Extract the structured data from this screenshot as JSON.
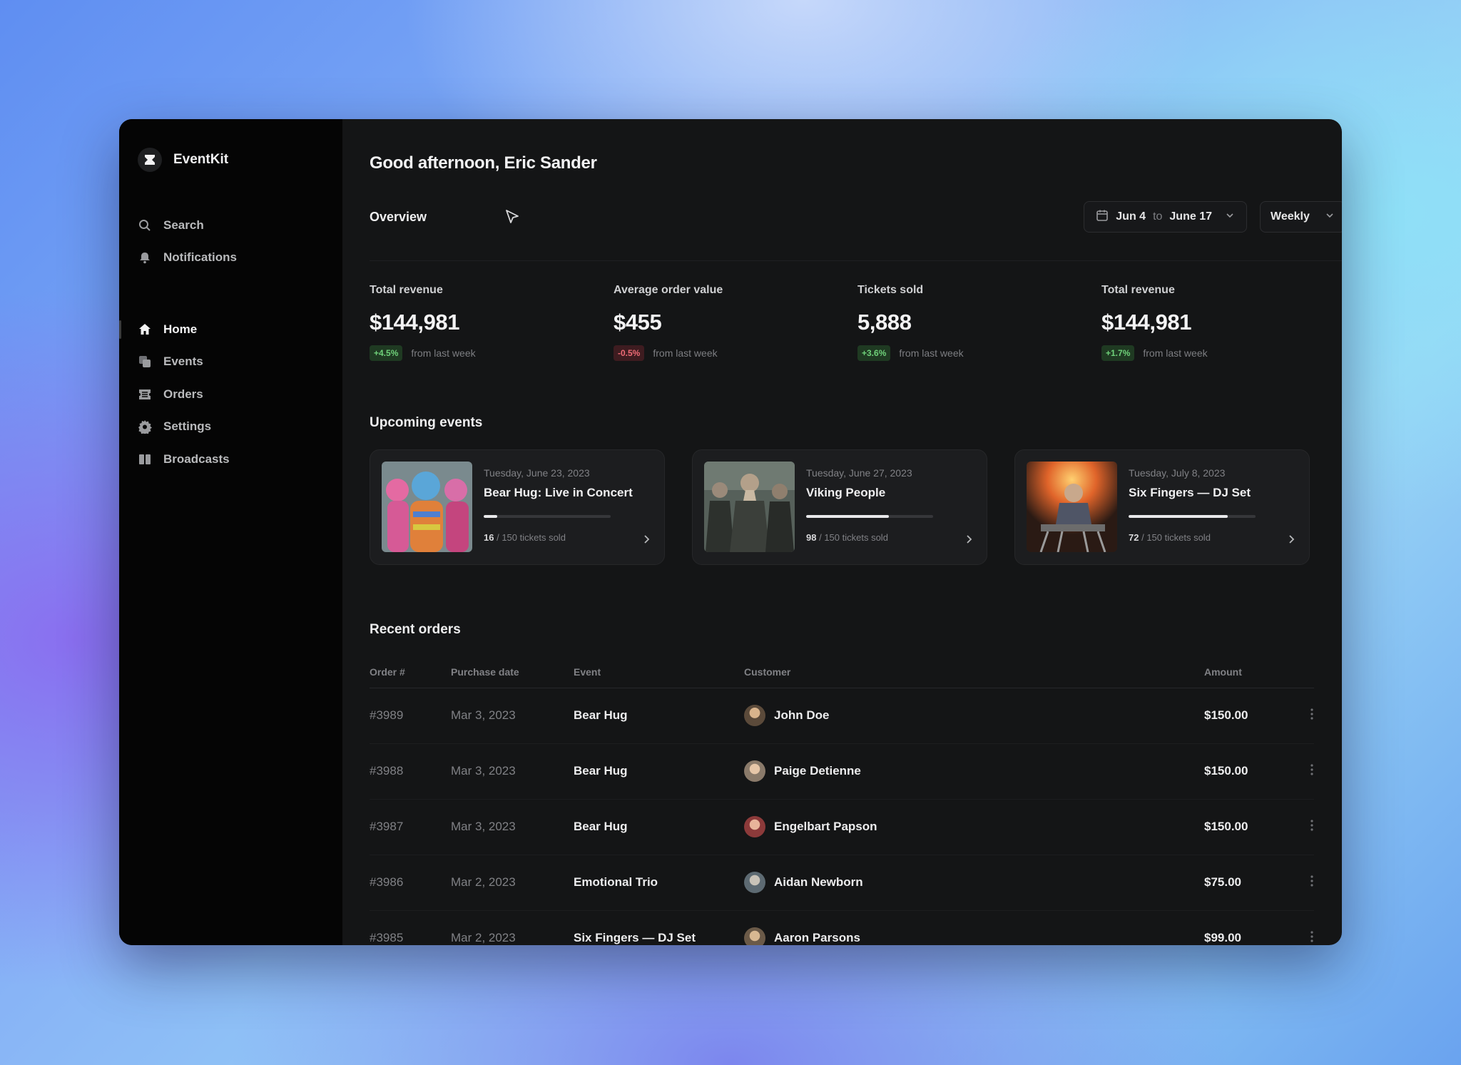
{
  "app": {
    "name": "EventKit"
  },
  "sidebar": {
    "top_items": [
      {
        "label": "Search",
        "icon": "search-icon"
      },
      {
        "label": "Notifications",
        "icon": "bell-icon"
      }
    ],
    "items": [
      {
        "label": "Home",
        "icon": "home-icon",
        "active": true
      },
      {
        "label": "Events",
        "icon": "events-icon"
      },
      {
        "label": "Orders",
        "icon": "ticket-icon"
      },
      {
        "label": "Settings",
        "icon": "gear-icon"
      },
      {
        "label": "Broadcasts",
        "icon": "broadcast-icon"
      }
    ]
  },
  "header": {
    "greeting": "Good afternoon, Eric Sander"
  },
  "overview": {
    "title": "Overview",
    "date_from": "Jun 4",
    "date_sep": "to",
    "date_to": "June 17",
    "period": "Weekly",
    "stats": [
      {
        "label": "Total revenue",
        "value": "$144,981",
        "change": "+4.5%",
        "trend": "up",
        "note": "from last week"
      },
      {
        "label": "Average order value",
        "value": "$455",
        "change": "-0.5%",
        "trend": "down",
        "note": "from last week"
      },
      {
        "label": "Tickets sold",
        "value": "5,888",
        "change": "+3.6%",
        "trend": "up",
        "note": "from last week"
      },
      {
        "label": "Total revenue",
        "value": "$144,981",
        "change": "+1.7%",
        "trend": "up",
        "note": "from last week"
      }
    ]
  },
  "upcoming": {
    "title": "Upcoming events",
    "events": [
      {
        "date": "Tuesday, June 23, 2023",
        "name": "Bear Hug: Live in Concert",
        "sold": "16",
        "total_text": "/ 150 tickets sold",
        "progress": 0.107
      },
      {
        "date": "Tuesday, June 27, 2023",
        "name": "Viking People",
        "sold": "98",
        "total_text": "/ 150 tickets sold",
        "progress": 0.653
      },
      {
        "date": "Tuesday, July 8, 2023",
        "name": "Six Fingers — DJ Set",
        "sold": "72",
        "total_text": "/ 150 tickets sold",
        "progress": 0.78
      }
    ]
  },
  "orders": {
    "title": "Recent orders",
    "columns": {
      "order": "Order #",
      "date": "Purchase date",
      "event": "Event",
      "customer": "Customer",
      "amount": "Amount"
    },
    "rows": [
      {
        "order": "#3989",
        "date": "Mar 3, 2023",
        "event": "Bear Hug",
        "customer": "John Doe",
        "amount": "$150.00"
      },
      {
        "order": "#3988",
        "date": "Mar 3, 2023",
        "event": "Bear Hug",
        "customer": "Paige Detienne",
        "amount": "$150.00"
      },
      {
        "order": "#3987",
        "date": "Mar 3, 2023",
        "event": "Bear Hug",
        "customer": "Engelbart Papson",
        "amount": "$150.00"
      },
      {
        "order": "#3986",
        "date": "Mar 2, 2023",
        "event": "Emotional Trio",
        "customer": "Aidan Newborn",
        "amount": "$75.00"
      },
      {
        "order": "#3985",
        "date": "Mar 2, 2023",
        "event": "Six Fingers — DJ Set",
        "customer": "Aaron Parsons",
        "amount": "$99.00"
      }
    ]
  },
  "colors": {
    "positive": "#6fd17a",
    "negative": "#ef6b76",
    "background": "#141516",
    "sidebar": "#050505"
  }
}
